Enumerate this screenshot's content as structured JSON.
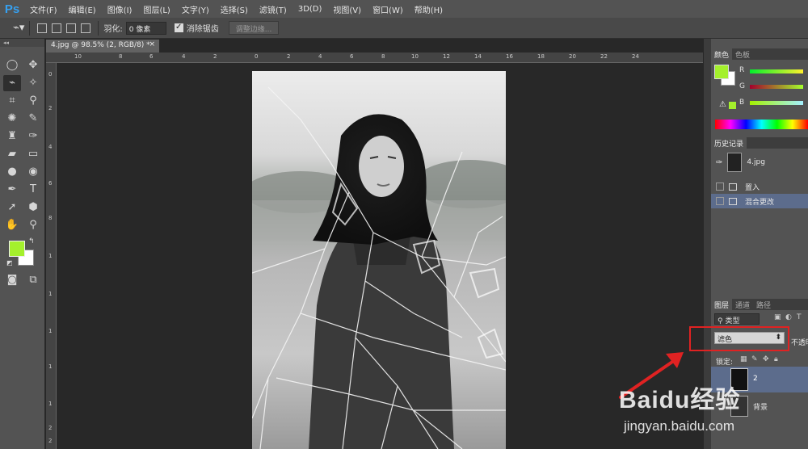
{
  "app": {
    "logo": "Ps"
  },
  "menu": [
    "文件(F)",
    "编辑(E)",
    "图像(I)",
    "图层(L)",
    "文字(Y)",
    "选择(S)",
    "滤镜(T)",
    "3D(D)",
    "视图(V)",
    "窗口(W)",
    "帮助(H)"
  ],
  "options": {
    "feather_label": "羽化:",
    "feather_value": "0 像素",
    "antialias_label": "消除锯齿",
    "refine_edge_label": "调整边缘..."
  },
  "document": {
    "tab_title": "4.jpg @ 98.5% (2, RGB/8) *",
    "close": "×"
  },
  "rulers": {
    "top": [
      "10",
      "8",
      "6",
      "4",
      "2",
      "0",
      "2",
      "4",
      "6",
      "8",
      "10",
      "12",
      "14",
      "16",
      "18",
      "20",
      "22",
      "24"
    ],
    "left": [
      "0",
      "2",
      "4",
      "6",
      "8",
      "1",
      "1",
      "1",
      "1",
      "1",
      "2",
      "2"
    ]
  },
  "colors": {
    "foreground": "#a4f02c",
    "background": "#ffffff",
    "accent_selection": "#5c6c8c",
    "highlight_box": "#e02222"
  },
  "panels": {
    "color_tabs": [
      "颜色",
      "色板"
    ],
    "color_channels": [
      "R",
      "G",
      "B"
    ],
    "history_tab": "历史记录",
    "history_snapshot": "4.jpg",
    "history_items": [
      "置入",
      "混合更改"
    ],
    "layers_tabs": [
      "图层",
      "通道",
      "路径"
    ],
    "layer_filter": "类型",
    "blend_mode": "滤色",
    "opacity_label": "不透明",
    "lock_label": "锁定:",
    "layers": [
      {
        "name": "2"
      },
      {
        "name": "背景"
      }
    ]
  },
  "watermark": {
    "brand": "Baidu经验",
    "url": "jingyan.baidu.com"
  }
}
